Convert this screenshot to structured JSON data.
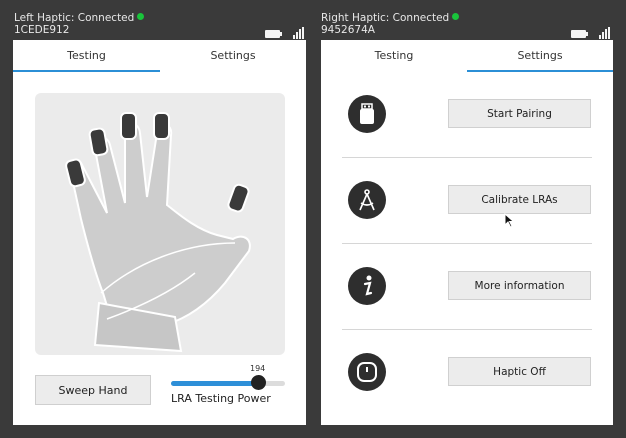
{
  "left": {
    "title": "Left Haptic: Connected",
    "device_id": "1CEDE912",
    "status_color": "#19c43b",
    "tabs": [
      {
        "label": "Testing"
      },
      {
        "label": "Settings"
      }
    ],
    "active_tab": "Testing",
    "sweep_label": "Sweep Hand",
    "slider": {
      "value": "194",
      "min": 0,
      "max": 255,
      "label": "LRA Testing Power"
    }
  },
  "right": {
    "title": "Right Haptic: Connected",
    "device_id": "9452674A",
    "status_color": "#19c43b",
    "tabs": [
      {
        "label": "Testing"
      },
      {
        "label": "Settings"
      }
    ],
    "active_tab": "Settings",
    "rows": [
      {
        "icon": "usb-stick-icon",
        "label": "Start Pairing"
      },
      {
        "icon": "compass-icon",
        "label": "Calibrate LRAs"
      },
      {
        "icon": "info-icon",
        "label": "More information"
      },
      {
        "icon": "power-icon",
        "label": "Haptic Off"
      }
    ]
  },
  "accent_color": "#2b8fd6"
}
